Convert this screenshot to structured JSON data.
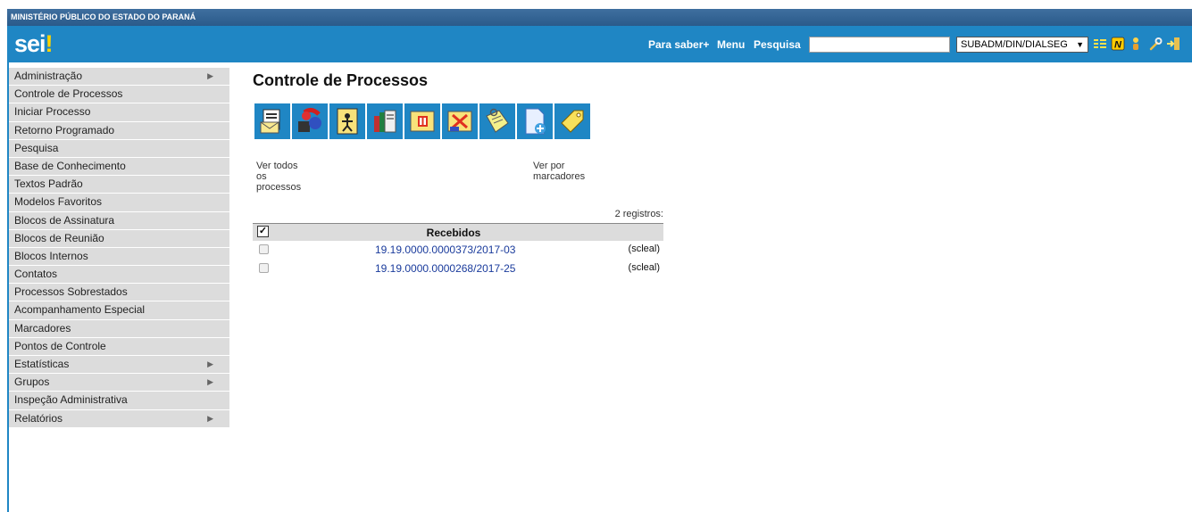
{
  "header": {
    "org_name": "MINISTÉRIO PÚBLICO DO ESTADO DO PARANÁ",
    "logo_text": "sei",
    "logo_dot": "!",
    "nav": {
      "para_saber": "Para saber+",
      "menu": "Menu",
      "pesquisa": "Pesquisa"
    },
    "search_value": "",
    "unit_selected": "SUBADM/DIN/DIALSEG",
    "icons": [
      "list-icon",
      "notes-icon",
      "user-icon",
      "wrench-icon",
      "exit-icon"
    ],
    "colors": {
      "app_bar": "#1f86c4",
      "org_bar": "#2a5a8a"
    }
  },
  "sidebar": {
    "items": [
      {
        "label": "Administração",
        "has_submenu": true
      },
      {
        "label": "Controle de Processos",
        "has_submenu": false
      },
      {
        "label": "Iniciar Processo",
        "has_submenu": false
      },
      {
        "label": "Retorno Programado",
        "has_submenu": false
      },
      {
        "label": "Pesquisa",
        "has_submenu": false
      },
      {
        "label": "Base de Conhecimento",
        "has_submenu": false
      },
      {
        "label": "Textos Padrão",
        "has_submenu": false
      },
      {
        "label": "Modelos Favoritos",
        "has_submenu": false
      },
      {
        "label": "Blocos de Assinatura",
        "has_submenu": false
      },
      {
        "label": "Blocos de Reunião",
        "has_submenu": false
      },
      {
        "label": "Blocos Internos",
        "has_submenu": false
      },
      {
        "label": "Contatos",
        "has_submenu": false
      },
      {
        "label": "Processos Sobrestados",
        "has_submenu": false
      },
      {
        "label": "Acompanhamento Especial",
        "has_submenu": false
      },
      {
        "label": "Marcadores",
        "has_submenu": false
      },
      {
        "label": "Pontos de Controle",
        "has_submenu": false
      },
      {
        "label": "Estatísticas",
        "has_submenu": true
      },
      {
        "label": "Grupos",
        "has_submenu": true
      },
      {
        "label": "Inspeção Administrativa",
        "has_submenu": false
      },
      {
        "label": "Relatórios",
        "has_submenu": true
      }
    ],
    "submenu_arrow": "▶"
  },
  "main": {
    "title": "Controle de Processos",
    "toolbar_icons": [
      "send-process-icon",
      "update-process-icon",
      "assign-process-icon",
      "library-icon",
      "sobrestar-icon",
      "conclude-process-icon",
      "annotation-icon",
      "include-document-icon",
      "marker-icon"
    ],
    "ver_todos": "Ver todos os processos",
    "ver_marcadores": "Ver por marcadores",
    "registros": "2 registros:",
    "table": {
      "header_label": "Recebidos",
      "header_check": "✓",
      "rows": [
        {
          "process": "19.19.0000.0000373/2017-03",
          "user": "(scleal)"
        },
        {
          "process": "19.19.0000.0000268/2017-25",
          "user": "(scleal)"
        }
      ]
    }
  }
}
